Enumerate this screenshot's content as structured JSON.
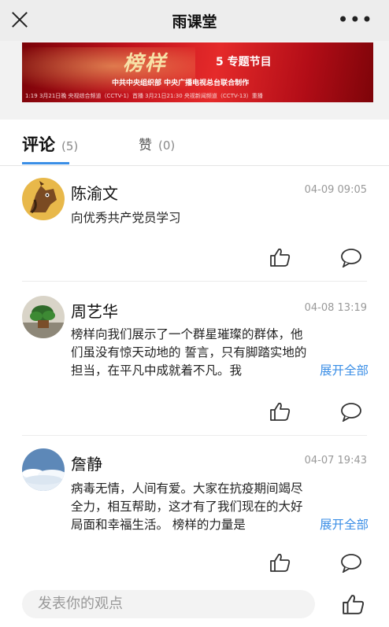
{
  "header": {
    "title": "雨课堂",
    "close_icon": "close-icon",
    "more_label": "•••"
  },
  "banner": {
    "title": "榜样",
    "subtitle": "5 专题节目",
    "line": "中共中央组织部  中央广播电视总台联合制作",
    "footer": "1:19  3月21日晚  央视综合频道（CCTV-1）首播    3月21日21:30  央视新闻频道（CCTV-13）重播"
  },
  "tabs": [
    {
      "label": "评论",
      "count": "(5)",
      "active": true
    },
    {
      "label": "赞",
      "count": "(0)",
      "active": false
    }
  ],
  "comments": [
    {
      "name": "陈渝文",
      "time": "04-09 09:05",
      "lines": [
        "向优秀共产党员学习"
      ],
      "expand": ""
    },
    {
      "name": "周艺华",
      "time": "04-08 13:19",
      "lines": [
        "榜样向我们展示了一个群星璀璨的群体，他",
        "们虽没有惊天动地的 誓言，只有脚踏实地的",
        "担当，在平凡中成就着不凡。我"
      ],
      "expand": "展开全部"
    },
    {
      "name": "詹静",
      "time": "04-07 19:43",
      "lines": [
        "病毒无情，人间有爱。大家在抗疫期间竭尽",
        "全力，相互帮助，这才有了我们现在的大好",
        "局面和幸福生活。 榜样的力量是"
      ],
      "expand": "展开全部"
    }
  ],
  "bottom": {
    "placeholder": "发表你的观点"
  },
  "colors": {
    "accent": "#3a8ee6",
    "banner_red": "#c1121c"
  }
}
